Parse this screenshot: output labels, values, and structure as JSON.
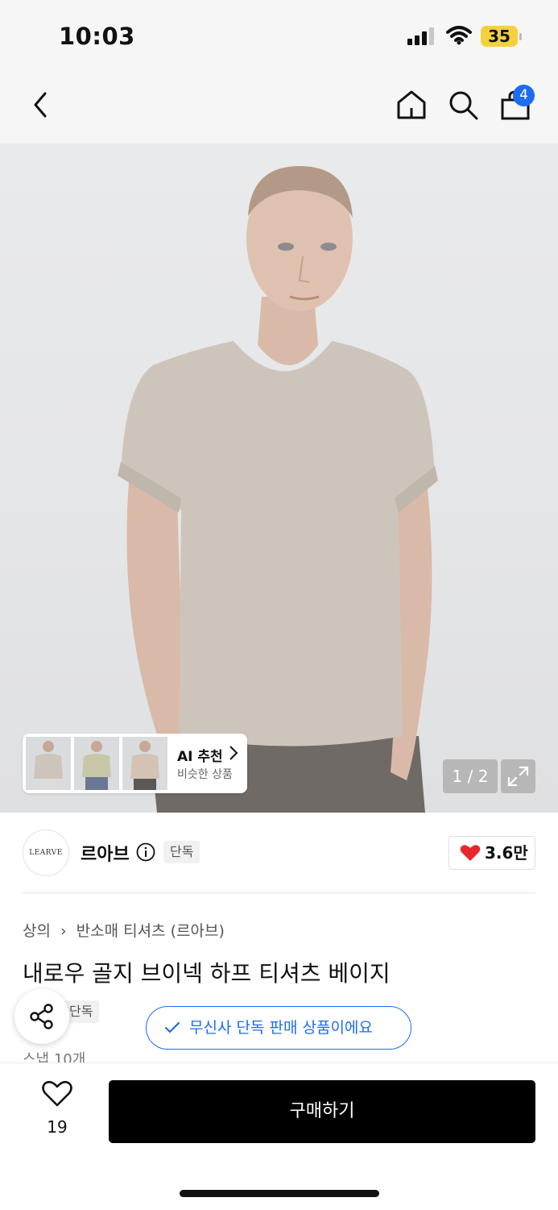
{
  "status_bar": {
    "time": "10:03",
    "battery": "35"
  },
  "header": {
    "cart_count": "4"
  },
  "gallery": {
    "ai_card": {
      "title": "AI 추천",
      "subtitle": "비슷한 상품"
    },
    "pager": "1 / 2"
  },
  "brand": {
    "logo_text": "LEARVE",
    "name": "르아브",
    "exclusive_tag": "단독",
    "likes": "3.6만"
  },
  "product": {
    "breadcrumb": [
      "상의",
      "반소매 티셔츠 (르아브)"
    ],
    "title": "내로우 골지 브이넥 하프 티셔츠 베이지",
    "exclusive_tag": "단독",
    "exclusive_notice": "무신사 단독 판매 상품이에요",
    "stock_partial": "스냅 10개"
  },
  "bottom_bar": {
    "favorite_count": "19",
    "buy_label": "구매하기"
  },
  "colors": {
    "accent_blue": "#1d6cf2",
    "heart_red": "#e8262c",
    "battery_yellow": "#f4d03f",
    "buy_black": "#000000"
  },
  "icons": [
    "back-icon",
    "home-icon",
    "search-icon",
    "shopping-bag-icon",
    "info-icon",
    "heart-icon",
    "share-icon",
    "check-icon",
    "expand-icon",
    "chevron-right-icon",
    "heart-outline-icon"
  ]
}
